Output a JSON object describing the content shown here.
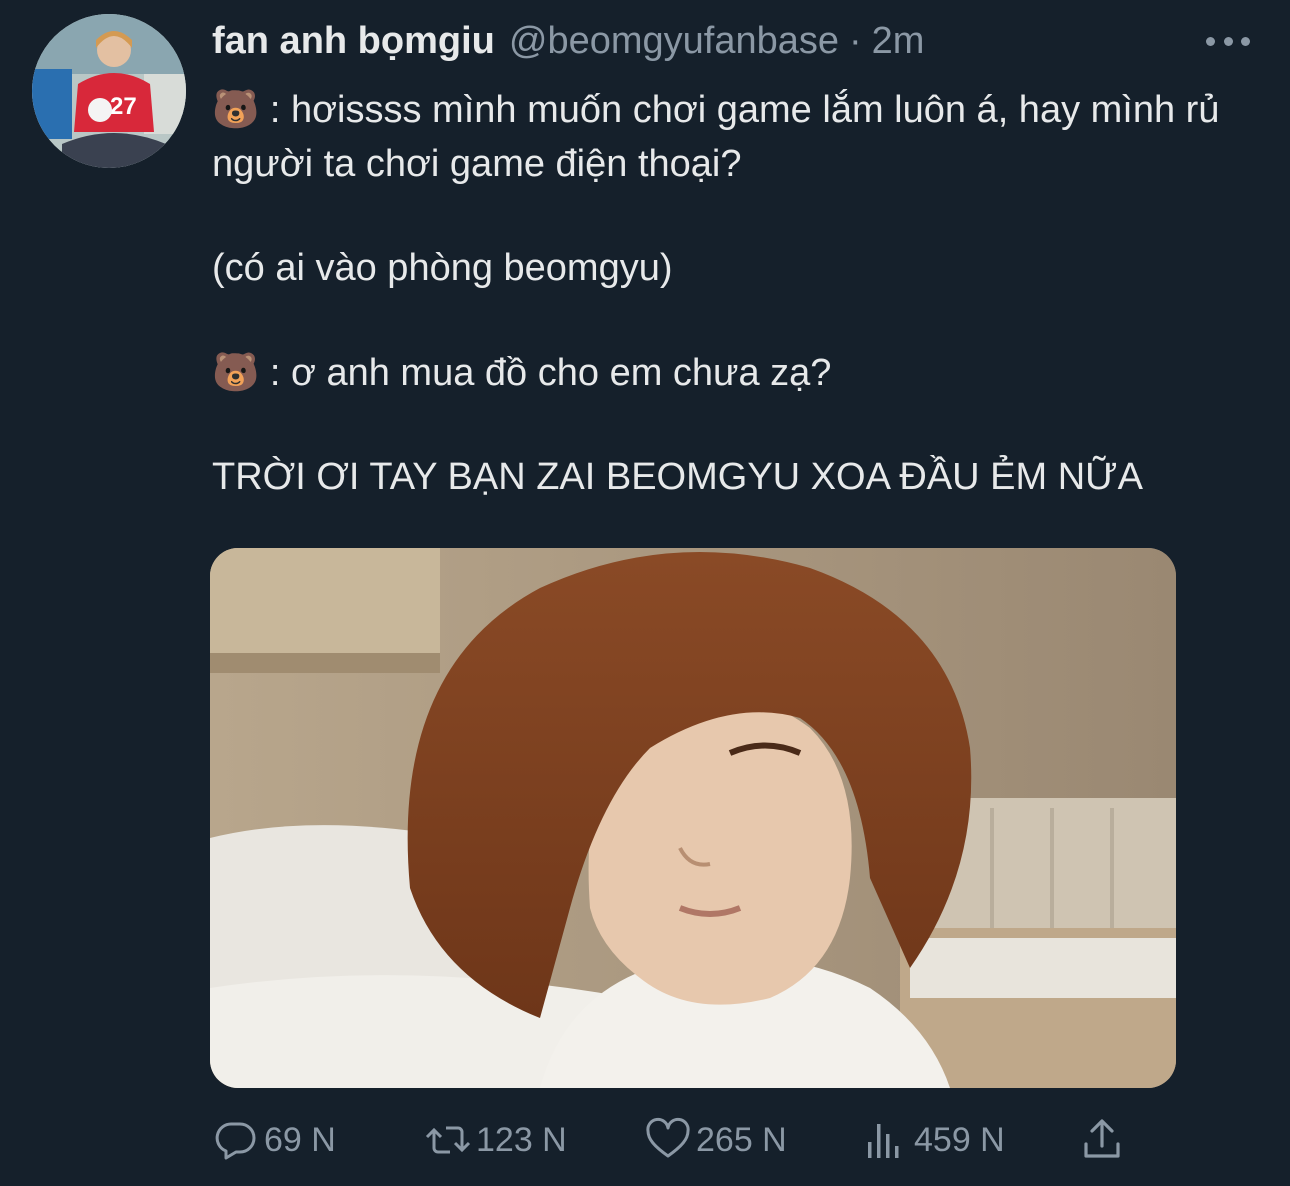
{
  "tweet": {
    "display_name": "fan anh bọmgiu",
    "handle": "@beomgyufanbase",
    "separator": "·",
    "time": "2m",
    "emoji": "🐻",
    "line1_text": " : hơissss mình muốn chơi game lắm luôn á, hay mình rủ người ta chơi game điện thoại?",
    "line2": "(có ai vào phòng beomgyu)",
    "line3_text": " : ơ anh mua đồ cho em chưa zạ?",
    "line4": "TRỜI ƠI TAY BẠN ZAI BEOMGYU XOA ĐẦU ẺM NỮA"
  },
  "actions": {
    "replies": "69 N",
    "retweets": "123 N",
    "likes": "265 N",
    "views": "459 N"
  },
  "icons": {
    "reply": "reply-icon",
    "retweet": "retweet-icon",
    "like": "heart-icon",
    "views": "views-icon",
    "share": "share-icon",
    "more": "more-icon"
  },
  "colors": {
    "background": "#15202b",
    "text": "#e7e9ea",
    "secondary": "#8b98a5"
  }
}
